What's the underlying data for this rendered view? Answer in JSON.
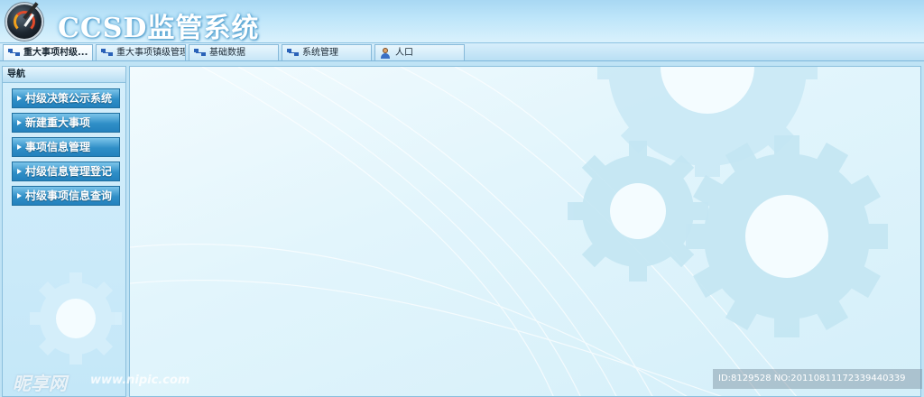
{
  "header": {
    "title": "CCSD监管系统",
    "logo_icon": "speedometer-logo-icon"
  },
  "tabs": [
    {
      "label": "重大事项村级...",
      "icon": "tree-icon",
      "active": true
    },
    {
      "label": "重大事项镇级管理",
      "icon": "tree-icon",
      "active": false
    },
    {
      "label": "基础数据",
      "icon": "tree-icon",
      "active": false
    },
    {
      "label": "系统管理",
      "icon": "tree-icon",
      "active": false
    },
    {
      "label": "人口",
      "icon": "user-icon",
      "active": false
    }
  ],
  "sidebar": {
    "heading": "导航",
    "items": [
      {
        "label": "村级决策公示系统"
      },
      {
        "label": "新建重大事项"
      },
      {
        "label": "事项信息管理"
      },
      {
        "label": "村级信息管理登记"
      },
      {
        "label": "村级事项信息查询"
      }
    ]
  },
  "watermark": {
    "brand": "昵享网",
    "url": "www.nipic.com",
    "id_text": "ID:8129528 NO:20110811172339440339"
  },
  "colors": {
    "accent": "#2f8fc7",
    "header_bg": "#bfe6fa",
    "title_text": "#ffffff"
  }
}
